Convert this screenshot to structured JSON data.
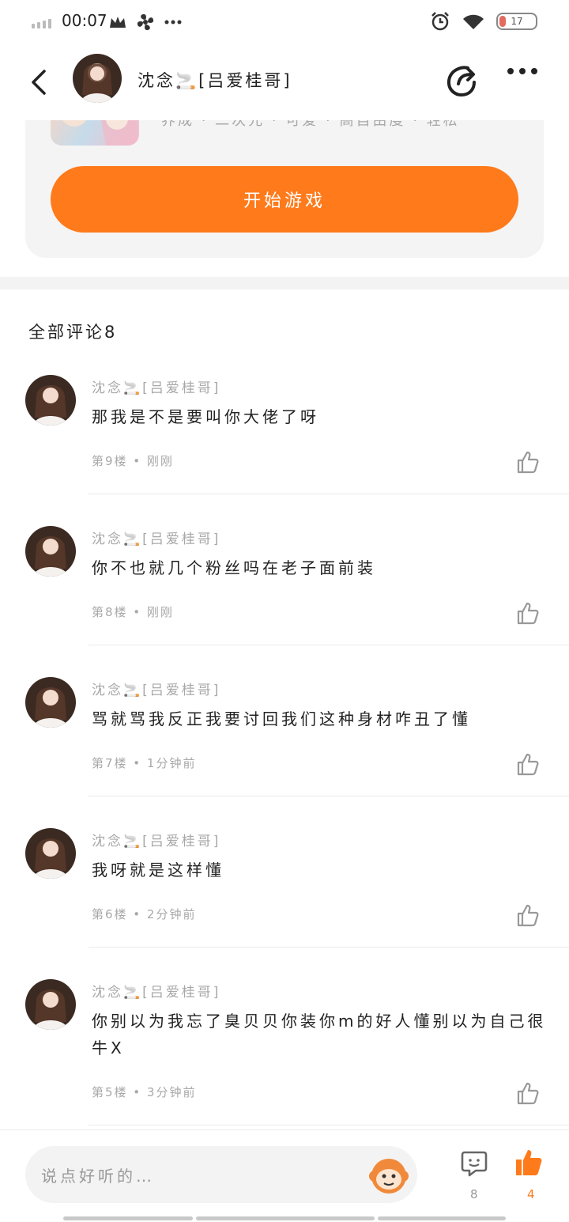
{
  "status_bar": {
    "time": "00:07",
    "battery": "17"
  },
  "header": {
    "title": "沈念🚬[吕爱桂哥]"
  },
  "game_card": {
    "tags": "养成 · 二次元 · 可爱 · 高自由度 · 轻松",
    "start_button": "开始游戏"
  },
  "comments_section": {
    "title": "全部评论8"
  },
  "comments": [
    {
      "name": "沈念🚬[吕爱桂哥]",
      "text": "那我是不是要叫你大佬了呀",
      "meta": "第9楼 • 刚刚"
    },
    {
      "name": "沈念🚬[吕爱桂哥]",
      "text": "你不也就几个粉丝吗在老子面前装",
      "meta": "第8楼 • 刚刚"
    },
    {
      "name": "沈念🚬[吕爱桂哥]",
      "text": "骂就骂我反正我要讨回我们这种身材咋丑了懂",
      "meta": "第7楼 • 1分钟前"
    },
    {
      "name": "沈念🚬[吕爱桂哥]",
      "text": "我呀就是这样懂",
      "meta": "第6楼 • 2分钟前"
    },
    {
      "name": "沈念🚬[吕爱桂哥]",
      "text": "你别以为我忘了臭贝贝你装你m的好人懂别以为自己很牛X",
      "meta": "第5楼 • 3分钟前"
    }
  ],
  "bottom_bar": {
    "input_placeholder": "说点好听的…",
    "comment_count": "8",
    "like_count": "4"
  },
  "colors": {
    "accent": "#ff7a1a",
    "muted_text": "#a8a8a8"
  }
}
